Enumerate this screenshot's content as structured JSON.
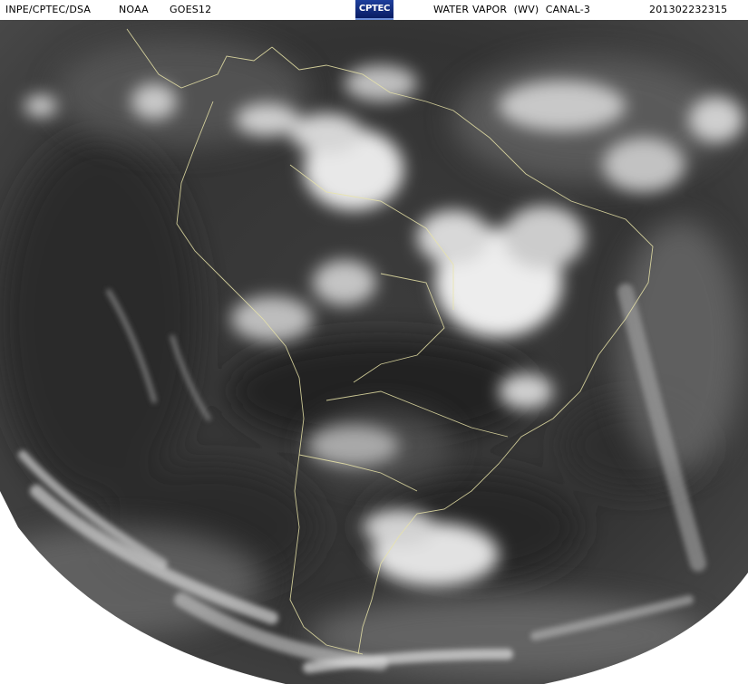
{
  "header": {
    "source": "INPE/CPTEC/DSA",
    "agency": "NOAA",
    "satellite": "GOES12",
    "logo_text": "CPTEC",
    "product": "WATER VAPOR  (WV)  CANAL-3",
    "timestamp": "201302232315"
  },
  "colors": {
    "header_bg": "#ffffff",
    "header_text": "#000000",
    "logo_bg": "#1e3f9c",
    "coastline": "#e9e4a8",
    "sky_dark": "#2b2b2b",
    "cloud_bright": "#f2f2f2"
  }
}
